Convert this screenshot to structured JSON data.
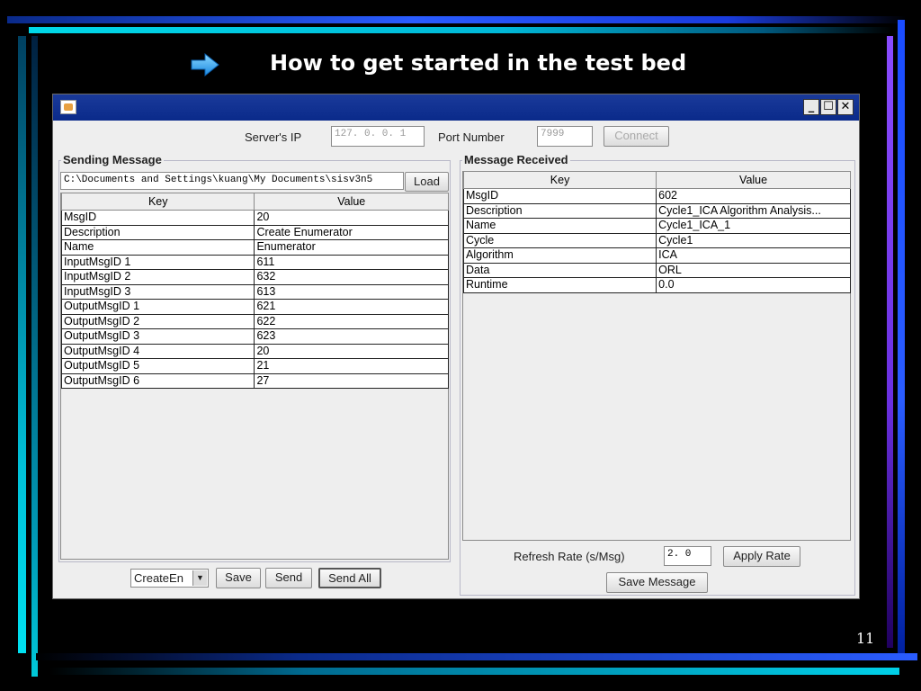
{
  "slide": {
    "title": "How to get started in the test bed",
    "page_number": "11"
  },
  "window": {
    "server_ip_label": "Server's IP",
    "server_ip_value": "127. 0. 0. 1",
    "port_label": "Port Number",
    "port_value": "7999",
    "connect_label": "Connect",
    "minimize": "_",
    "maximize": "☐",
    "close": "✕"
  },
  "sending": {
    "title": "Sending Message",
    "path": "C:\\Documents and Settings\\kuang\\My Documents\\sisv3n5",
    "load_label": "Load",
    "headers": [
      "Key",
      "Value"
    ],
    "rows": [
      [
        "MsgID",
        "20"
      ],
      [
        "Description",
        "Create Enumerator"
      ],
      [
        "Name",
        "Enumerator"
      ],
      [
        "InputMsgID 1",
        "611"
      ],
      [
        "InputMsgID 2",
        "632"
      ],
      [
        "InputMsgID 3",
        "613"
      ],
      [
        "OutputMsgID 1",
        "621"
      ],
      [
        "OutputMsgID 2",
        "622"
      ],
      [
        "OutputMsgID 3",
        "623"
      ],
      [
        "OutputMsgID 4",
        "20"
      ],
      [
        "OutputMsgID 5",
        "21"
      ],
      [
        "OutputMsgID 6",
        "27"
      ]
    ],
    "select_value": "CreateEn",
    "save_label": "Save",
    "send_label": "Send",
    "send_all_label": "Send All"
  },
  "received": {
    "title": "Message Received",
    "headers": [
      "Key",
      "Value"
    ],
    "rows": [
      [
        "MsgID",
        "602"
      ],
      [
        "Description",
        "Cycle1_ICA Algorithm Analysis..."
      ],
      [
        "Name",
        "Cycle1_ICA_1"
      ],
      [
        "Cycle",
        "Cycle1"
      ],
      [
        "Algorithm",
        "ICA"
      ],
      [
        "Data",
        "ORL"
      ],
      [
        "Runtime",
        "0.0"
      ]
    ],
    "refresh_label": "Refresh Rate (s/Msg)",
    "refresh_value": "2. 0",
    "apply_label": "Apply Rate",
    "save_message_label": "Save Message"
  },
  "colors": {
    "titlebar": "#0a2a8a",
    "panel": "#eeeeee"
  }
}
